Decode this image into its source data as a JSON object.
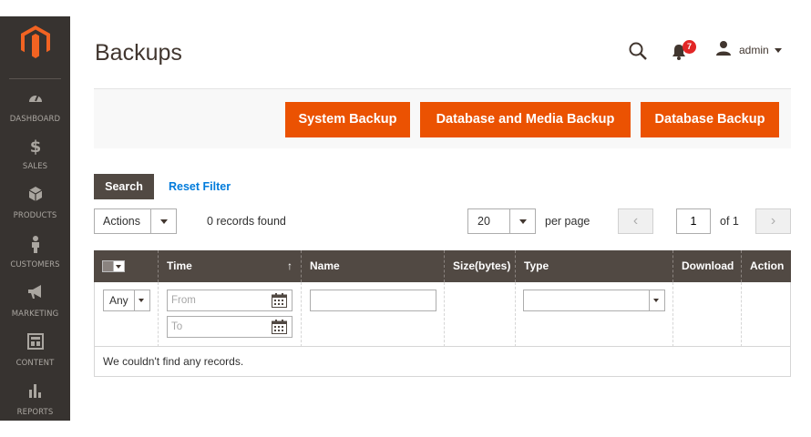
{
  "sidebar": {
    "logo": "magento-logo",
    "items": [
      {
        "label": "DASHBOARD",
        "icon": "speedometer-icon"
      },
      {
        "label": "SALES",
        "icon": "dollar-icon"
      },
      {
        "label": "PRODUCTS",
        "icon": "cube-icon"
      },
      {
        "label": "CUSTOMERS",
        "icon": "person-icon"
      },
      {
        "label": "MARKETING",
        "icon": "megaphone-icon"
      },
      {
        "label": "CONTENT",
        "icon": "layout-icon"
      },
      {
        "label": "REPORTS",
        "icon": "bar-chart-icon"
      }
    ]
  },
  "header": {
    "title": "Backups",
    "notifications_count": "7",
    "user_name": "admin"
  },
  "actions": {
    "system_backup": "System Backup",
    "db_media_backup": "Database and Media Backup",
    "db_backup": "Database Backup"
  },
  "search": {
    "search_label": "Search",
    "reset_label": "Reset Filter"
  },
  "toolbar": {
    "actions_label": "Actions",
    "records_found": "0 records found",
    "per_page_value": "20",
    "per_page_label": "per page",
    "current_page": "1",
    "of_pages": "of 1"
  },
  "grid": {
    "columns": [
      "Time",
      "Name",
      "Size(bytes)",
      "Type",
      "Download",
      "Action"
    ],
    "sort_indicator": "↑",
    "filters": {
      "any_value": "Any",
      "from_placeholder": "From",
      "to_placeholder": "To"
    },
    "empty_message": "We couldn't find any records."
  },
  "colors": {
    "accent": "#eb5202",
    "sidebar_bg": "#373330",
    "header_bg": "#514943",
    "link": "#007bdb"
  }
}
